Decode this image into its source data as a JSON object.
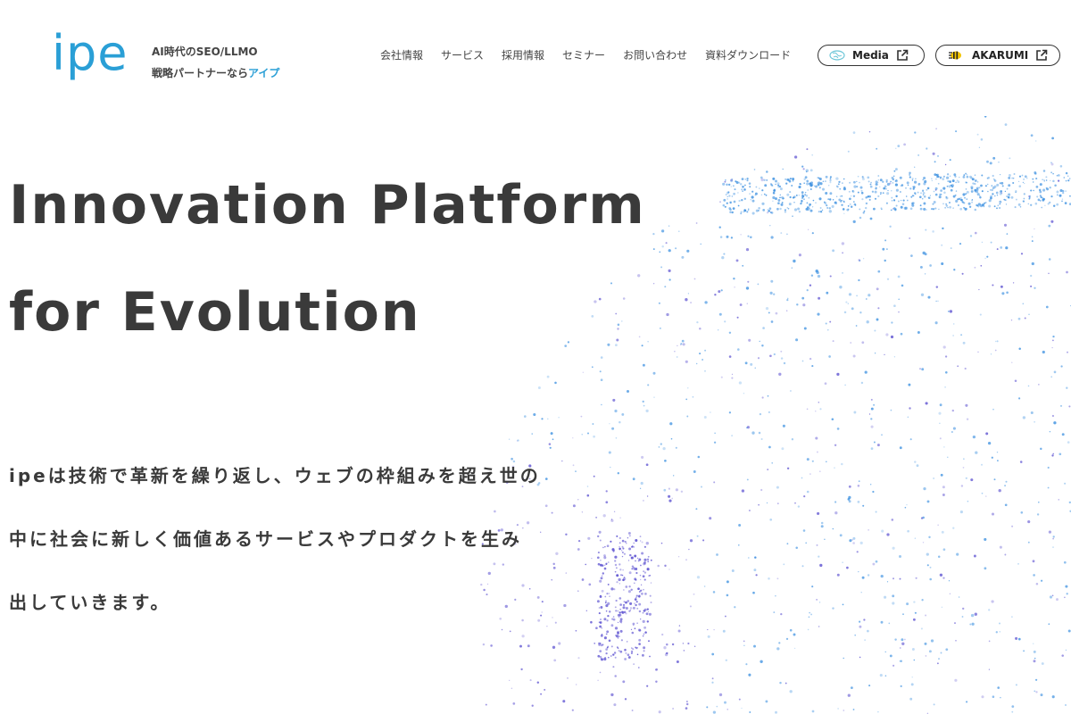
{
  "header": {
    "logo_text": "ipe",
    "tagline_line1": "AI時代のSEO/LLMO",
    "tagline_line2_prefix": "戦略パートナーなら",
    "tagline_line2_accent": "アイプ",
    "nav": [
      {
        "label": "会社情報"
      },
      {
        "label": "サービス"
      },
      {
        "label": "採用情報"
      },
      {
        "label": "セミナー"
      },
      {
        "label": "お問い合わせ"
      },
      {
        "label": "資料ダウンロード"
      }
    ],
    "media_button": {
      "label": "Media",
      "icon": "brain-icon"
    },
    "akarumi_button": {
      "label": "AKARUMI",
      "icon": "bee-icon"
    }
  },
  "hero": {
    "title_line1": "Innovation Platform",
    "title_line2": "for Evolution",
    "description_lines": [
      "ipeは技術で革新を繰り返し、ウェブの枠組みを超え世の",
      "中に社会に新しく価値あるサービスやプロダクトを生み",
      "出していきます。"
    ]
  },
  "colors": {
    "accent": "#2a9fd6",
    "text": "#3a3a3a",
    "globe_blue": "#3a8fe0",
    "globe_violet": "#5a4fd0"
  }
}
